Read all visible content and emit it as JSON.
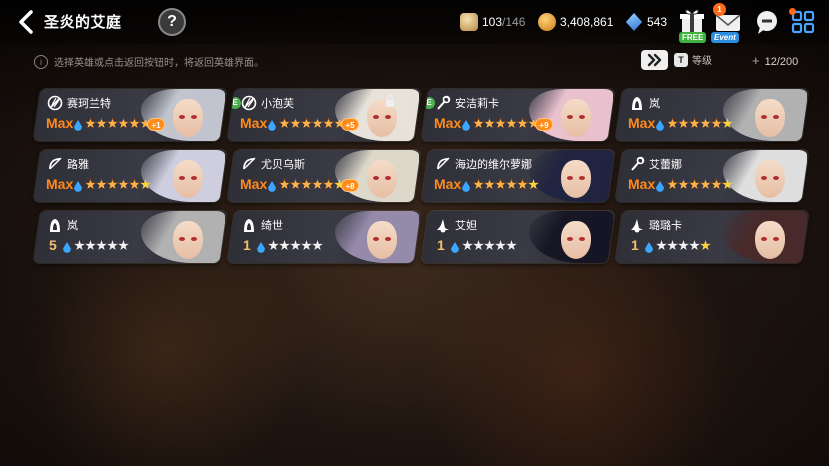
{
  "header": {
    "title": "圣炎的艾庭",
    "help_label": "?",
    "stamina": {
      "current": "103",
      "max": "/146"
    },
    "gold": "3,408,861",
    "crystal": "543",
    "free_tag": "FREE",
    "event_tag": "Event",
    "event_count": "1"
  },
  "subbar": {
    "hint": "选择英雄或点击返回按钮时，将返回英雄界面。",
    "hint_icon": "i",
    "sort_icon": "T",
    "sort_label": "等级",
    "count": "12/200"
  },
  "heroes": [
    {
      "name": "赛珂兰特",
      "level": "Max",
      "class": "no-icon",
      "stars": 6,
      "plus": "+1",
      "e": false,
      "locked": false,
      "hair": "#c9ccd6"
    },
    {
      "name": "小泡芙",
      "level": "Max",
      "class": "no-icon",
      "stars": 6,
      "plus": "+5",
      "e": true,
      "locked": true,
      "hair": "#f1ece2"
    },
    {
      "name": "安洁莉卡",
      "level": "Max",
      "class": "staff-icon",
      "stars": 6,
      "plus": "+9",
      "e": true,
      "locked": false,
      "hair": "#f3c9d6"
    },
    {
      "name": "岚",
      "level": "Max",
      "class": "hood-icon",
      "stars": 6,
      "plus": "",
      "e": false,
      "locked": false,
      "hair": "#b8b8b8"
    },
    {
      "name": "路雅",
      "level": "Max",
      "class": "bow-icon",
      "stars": 6,
      "plus": "",
      "e": false,
      "locked": false,
      "hair": "#d6d6e8"
    },
    {
      "name": "尤贝乌斯",
      "level": "Max",
      "class": "bow-icon",
      "stars": 6,
      "plus": "+8",
      "e": false,
      "locked": false,
      "hair": "#e6e2d2"
    },
    {
      "name": "海边的维尔萝娜",
      "level": "Max",
      "class": "bow-icon",
      "stars": 6,
      "plus": "",
      "e": false,
      "locked": false,
      "hair": "#1f2340"
    },
    {
      "name": "艾蕾娜",
      "level": "Max",
      "class": "staff-icon",
      "stars": 6,
      "plus": "",
      "e": false,
      "locked": false,
      "hair": "#e8e8e8"
    },
    {
      "name": "岚",
      "level": "5",
      "class": "hood-icon",
      "stars": 5,
      "plus": "",
      "e": false,
      "locked": false,
      "hair": "#b8b8b8"
    },
    {
      "name": "绮世",
      "level": "1",
      "class": "hood-icon",
      "stars": 5,
      "plus": "",
      "e": false,
      "locked": false,
      "hair": "#9a8fb0"
    },
    {
      "name": "艾妲",
      "level": "1",
      "class": "witch-icon",
      "stars": 5,
      "plus": "",
      "e": false,
      "locked": false,
      "hair": "#141424"
    },
    {
      "name": "璐璐卡",
      "level": "1",
      "class": "witch-icon",
      "stars": 5,
      "plus": "",
      "e": false,
      "locked": false,
      "hair": "#4a2a2a"
    }
  ]
}
